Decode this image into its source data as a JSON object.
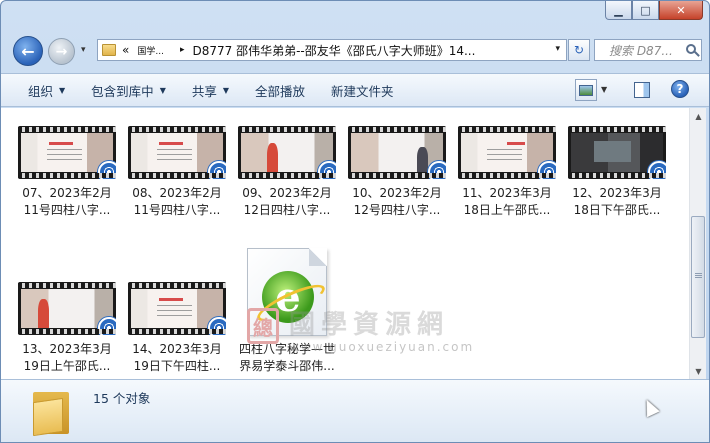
{
  "window": {
    "caption": {
      "minimize": "▁",
      "maximize": "□",
      "close": "✕"
    }
  },
  "nav": {
    "back": "←",
    "forward": "→",
    "dropdown": "▾",
    "address": {
      "prefix": "«",
      "part1": "国学...",
      "part2": "D8777 邵伟华弟弟--邵友华《邵氏八字大师班》14...",
      "dropdown": "▾"
    },
    "refresh": "↻",
    "search_placeholder": "搜索 D87..."
  },
  "toolbar": {
    "organize": "组织",
    "include_library": "包含到库中",
    "share": "共享",
    "play_all": "全部播放",
    "new_folder": "新建文件夹",
    "arrow": "▼",
    "help": "?"
  },
  "files": [
    {
      "line1": "07、2023年2月",
      "line2": "11号四柱八字...",
      "thumb": "slide"
    },
    {
      "line1": "08、2023年2月",
      "line2": "11号四柱八字...",
      "thumb": "slide"
    },
    {
      "line1": "09、2023年2月",
      "line2": "12日四柱八字...",
      "thumb": "room"
    },
    {
      "line1": "10、2023年2月",
      "line2": "12号四柱八字...",
      "thumb": "room"
    },
    {
      "line1": "11、2023年3月",
      "line2": "18日上午邵氏...",
      "thumb": "slide"
    },
    {
      "line1": "12、2023年3月",
      "line2": "18日下午邵氏...",
      "thumb": "dark"
    },
    {
      "line1": "13、2023年3月",
      "line2": "19日上午邵氏...",
      "thumb": "room"
    },
    {
      "line1": "14、2023年3月",
      "line2": "19日下午四柱...",
      "thumb": "slide"
    }
  ],
  "html_file": {
    "line1": "四柱八字秘学—世",
    "line2": "界易学泰斗邵伟..."
  },
  "watermark": {
    "seal": "總",
    "text": "國學資源網",
    "url": "www.guoxueziyuan.com"
  },
  "scrollbar": {
    "up": "▲",
    "down": "▼"
  },
  "details": {
    "count": "15 个对象"
  }
}
